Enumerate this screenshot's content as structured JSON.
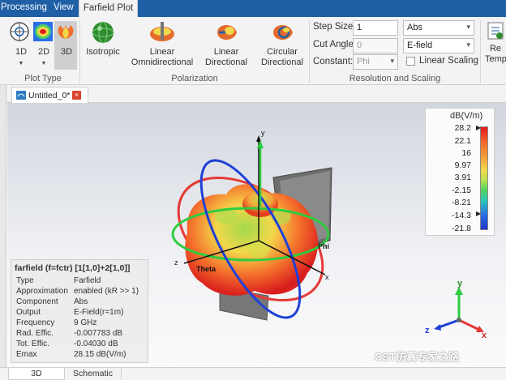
{
  "menu": {
    "processing": "Processing",
    "view": "View",
    "active_tab": "Farfield Plot"
  },
  "ribbon": {
    "plot_type": {
      "btn_1d": "1D",
      "btn_2d": "2D",
      "btn_3d": "3D",
      "group_label": "Plot Type"
    },
    "polarization": {
      "isotropic": "Isotropic",
      "linear_omni_1": "Linear",
      "linear_omni_2": "Omnidirectional",
      "linear_dir_1": "Linear",
      "linear_dir_2": "Directional",
      "circular_dir_1": "Circular",
      "circular_dir_2": "Directional",
      "group_label": "Polarization"
    },
    "resolution": {
      "step_size_label": "Step Size:",
      "step_size_value": "1",
      "cut_angle_label": "Cut Angle:",
      "cut_angle_value": "0",
      "constant_label": "Constant:",
      "constant_value": "Phi",
      "component_value": "Abs",
      "field_value": "E-field",
      "linear_scaling_label": "Linear Scaling",
      "group_label": "Resolution and Scaling"
    },
    "reset_1": "Re",
    "reset_2": "Temp"
  },
  "document_tab": {
    "title": "Untitled_0*"
  },
  "legend": {
    "title": "dB(V/m)",
    "ticks": [
      "28.2",
      "22.1",
      "16",
      "9.97",
      "3.91",
      "-2.15",
      "-8.21",
      "-14.3",
      "-21.8"
    ]
  },
  "axes": {
    "x": "x",
    "y": "y",
    "z": "z",
    "theta": "Theta",
    "phi": "Phi"
  },
  "info": {
    "header": "farfield (f=fctr) [1[1,0]+2[1,0]]",
    "rows": [
      {
        "k": "Type",
        "v": "Farfield"
      },
      {
        "k": "Approximation",
        "v": "enabled (kR >> 1)"
      },
      {
        "k": "Component",
        "v": "Abs"
      },
      {
        "k": "Output",
        "v": "E-Field(r=1m)"
      },
      {
        "k": "Frequency",
        "v": "9 GHz"
      },
      {
        "k": "Rad. Effic.",
        "v": "-0.007783 dB"
      },
      {
        "k": "Tot. Effic.",
        "v": "-0.04030 dB"
      },
      {
        "k": "Emax",
        "v": "28.15 dB(V/m)"
      }
    ]
  },
  "bottom_tabs": {
    "tab_3d": "3D",
    "tab_schematic": "Schematic"
  },
  "watermark": "CST仿真专家之路",
  "colors": {
    "accent": "#1f5fa6",
    "pattern_hot": "#e41a1c",
    "pattern_mid": "#f3d84b",
    "ring_red": "#e53935",
    "ring_green": "#2ecc40",
    "ring_blue": "#1e40d6"
  }
}
